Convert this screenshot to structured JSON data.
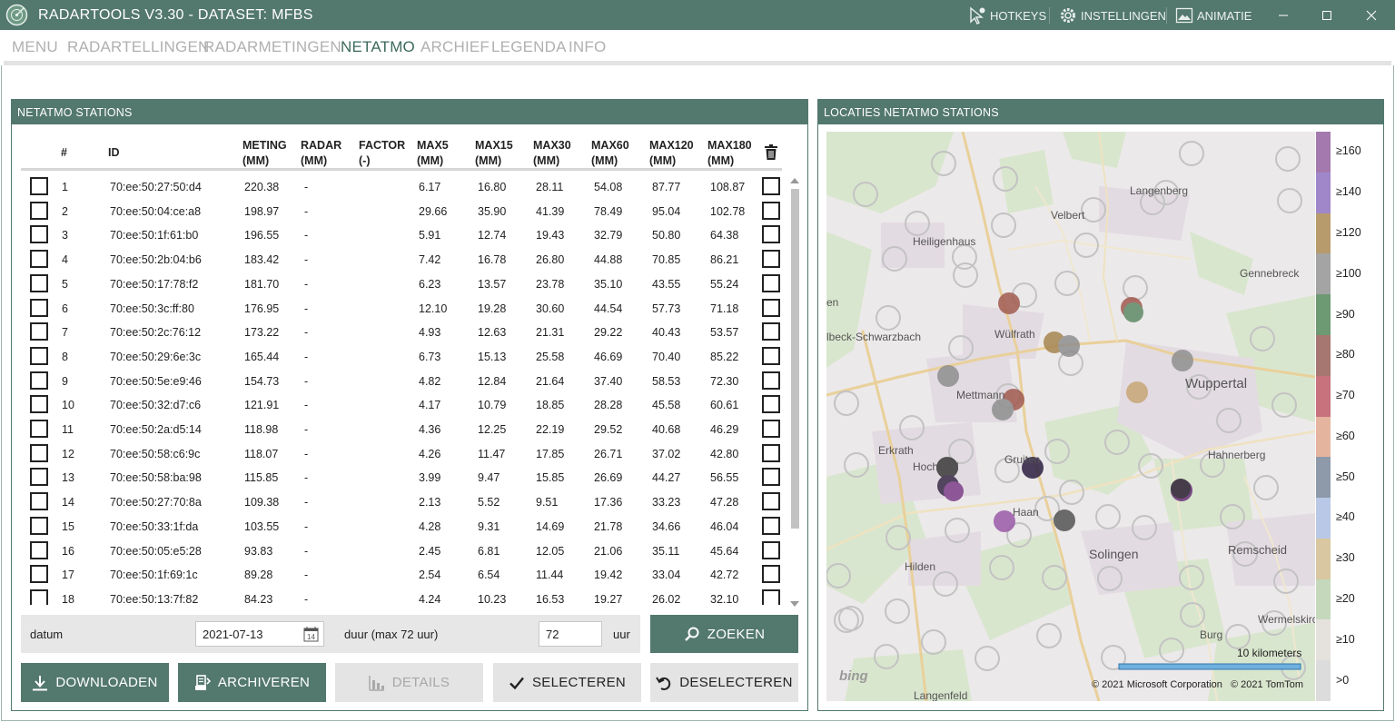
{
  "window": {
    "title": "RADARTOOLS V3.30 - DATASET: MFBS",
    "hotkeys_label": "HOTKEYS",
    "settings_label": "INSTELLINGEN",
    "animation_label": "ANIMATIE"
  },
  "menu": [
    {
      "label": "MENU",
      "active": false
    },
    {
      "label": "RADARTELLINGEN",
      "active": false
    },
    {
      "label": "RADARMETINGEN",
      "active": false
    },
    {
      "label": "NETATMO",
      "active": true
    },
    {
      "label": "ARCHIEF",
      "active": false
    },
    {
      "label": "LEGENDA",
      "active": false
    },
    {
      "label": "INFO",
      "active": false
    }
  ],
  "stations_panel": {
    "title": "NETATMO STATIONS",
    "headers": [
      "#",
      "ID",
      "METING\n(MM)",
      "RADAR\n(MM)",
      "FACTOR\n(-)",
      "MAX5\n(MM)",
      "MAX15\n(MM)",
      "MAX30\n(MM)",
      "MAX60\n(MM)",
      "MAX120\n(MM)",
      "MAX180\n(MM)"
    ],
    "rows": [
      [
        "1",
        "70:ee:50:27:50:d4",
        "220.38",
        "-",
        "",
        "6.17",
        "16.80",
        "28.11",
        "54.08",
        "87.77",
        "108.87"
      ],
      [
        "2",
        "70:ee:50:04:ce:a8",
        "198.97",
        "-",
        "",
        "29.66",
        "35.90",
        "41.39",
        "78.49",
        "95.04",
        "102.78"
      ],
      [
        "3",
        "70:ee:50:1f:61:b0",
        "196.55",
        "-",
        "",
        "5.91",
        "12.74",
        "19.43",
        "32.79",
        "50.80",
        "64.38"
      ],
      [
        "4",
        "70:ee:50:2b:04:b6",
        "183.42",
        "-",
        "",
        "7.42",
        "16.78",
        "26.80",
        "44.88",
        "70.85",
        "86.21"
      ],
      [
        "5",
        "70:ee:50:17:78:f2",
        "181.70",
        "-",
        "",
        "6.23",
        "13.57",
        "23.78",
        "35.10",
        "43.55",
        "55.24"
      ],
      [
        "6",
        "70:ee:50:3c:ff:80",
        "176.95",
        "-",
        "",
        "12.10",
        "19.28",
        "30.60",
        "44.54",
        "57.73",
        "71.18"
      ],
      [
        "7",
        "70:ee:50:2c:76:12",
        "173.22",
        "-",
        "",
        "4.93",
        "12.63",
        "21.31",
        "29.22",
        "40.43",
        "53.57"
      ],
      [
        "8",
        "70:ee:50:29:6e:3c",
        "165.44",
        "-",
        "",
        "6.73",
        "15.13",
        "25.58",
        "46.69",
        "70.40",
        "85.22"
      ],
      [
        "9",
        "70:ee:50:5e:e9:46",
        "154.73",
        "-",
        "",
        "4.82",
        "12.84",
        "21.64",
        "37.40",
        "58.53",
        "72.30"
      ],
      [
        "10",
        "70:ee:50:32:d7:c6",
        "121.91",
        "-",
        "",
        "4.17",
        "10.79",
        "18.85",
        "28.28",
        "45.58",
        "60.61"
      ],
      [
        "11",
        "70:ee:50:2a:d5:14",
        "118.98",
        "-",
        "",
        "4.36",
        "12.25",
        "22.19",
        "29.52",
        "40.68",
        "46.29"
      ],
      [
        "12",
        "70:ee:50:58:c6:9c",
        "118.07",
        "-",
        "",
        "4.26",
        "11.47",
        "17.85",
        "26.71",
        "37.02",
        "42.80"
      ],
      [
        "13",
        "70:ee:50:58:ba:98",
        "115.85",
        "-",
        "",
        "3.99",
        "9.47",
        "15.85",
        "26.69",
        "44.27",
        "56.55"
      ],
      [
        "14",
        "70:ee:50:27:70:8a",
        "109.38",
        "-",
        "",
        "2.13",
        "5.52",
        "9.51",
        "17.36",
        "33.23",
        "47.28"
      ],
      [
        "15",
        "70:ee:50:33:1f:da",
        "103.55",
        "-",
        "",
        "4.28",
        "9.31",
        "14.69",
        "21.78",
        "34.66",
        "46.04"
      ],
      [
        "16",
        "70:ee:50:05:e5:28",
        "93.83",
        "-",
        "",
        "2.45",
        "6.81",
        "12.05",
        "21.06",
        "35.11",
        "45.64"
      ],
      [
        "17",
        "70:ee:50:1f:69:1c",
        "89.28",
        "-",
        "",
        "2.54",
        "6.54",
        "11.44",
        "19.42",
        "33.04",
        "42.72"
      ],
      [
        "18",
        "70:ee:50:13:7f:82",
        "84.23",
        "-",
        "",
        "4.24",
        "10.23",
        "16.53",
        "19.27",
        "26.02",
        "32.10"
      ]
    ],
    "filter": {
      "date_label": "datum",
      "date_value": "2021-07-13",
      "duration_label": "duur (max 72 uur)",
      "duration_value": "72",
      "unit_label": "uur",
      "search_label": "ZOEKEN"
    },
    "buttons": {
      "download": "DOWNLOADEN",
      "archive": "ARCHIVEREN",
      "details": "DETAILS",
      "select": "SELECTEREN",
      "deselect": "DESELECTEREN"
    }
  },
  "map_panel": {
    "title": "LOCATIES NETATMO STATIONS",
    "places": [
      {
        "name": "Heiligenhaus"
      },
      {
        "name": "Velbert"
      },
      {
        "name": "Langenberg"
      },
      {
        "name": "Gennebreck"
      },
      {
        "name": "Wülfrath"
      },
      {
        "name": "lbeck-Schwarzbach"
      },
      {
        "name": "Mettmann"
      },
      {
        "name": "Wuppertal"
      },
      {
        "name": "Erkrath"
      },
      {
        "name": "Hochdahl"
      },
      {
        "name": "Gruiten"
      },
      {
        "name": "Hahnerberg"
      },
      {
        "name": "Haan"
      },
      {
        "name": "Solingen"
      },
      {
        "name": "Remscheid"
      },
      {
        "name": "Hilden"
      },
      {
        "name": "Wermelskirc"
      },
      {
        "name": "Burg"
      },
      {
        "name": "Langenfeld"
      },
      {
        "name": "en"
      }
    ],
    "scale_label": "10 kilometers",
    "copyright_ms": "© 2021 Microsoft Corporation",
    "copyright_tomtom": "© 2021 TomTom",
    "bing_label": "bing",
    "legend": [
      {
        "label": "≥160",
        "color": "#a47aae"
      },
      {
        "label": "≥140",
        "color": "#9f87c9"
      },
      {
        "label": "≥120",
        "color": "#b79b6c"
      },
      {
        "label": "≥100",
        "color": "#a4a4a4"
      },
      {
        "label": "≥90",
        "color": "#6d9a73"
      },
      {
        "label": "≥80",
        "color": "#a67670"
      },
      {
        "label": "≥70",
        "color": "#c7727c"
      },
      {
        "label": "≥60",
        "color": "#e5b49f"
      },
      {
        "label": "≥50",
        "color": "#8e9aa9"
      },
      {
        "label": "≥40",
        "color": "#b8c8e6"
      },
      {
        "label": "≥30",
        "color": "#d8c7a0"
      },
      {
        "label": "≥20",
        "color": "#c5d8bb"
      },
      {
        "label": "≥10",
        "color": "#e5e1dd"
      },
      {
        "label": ">0",
        "color": "#dcdcdc"
      }
    ]
  }
}
